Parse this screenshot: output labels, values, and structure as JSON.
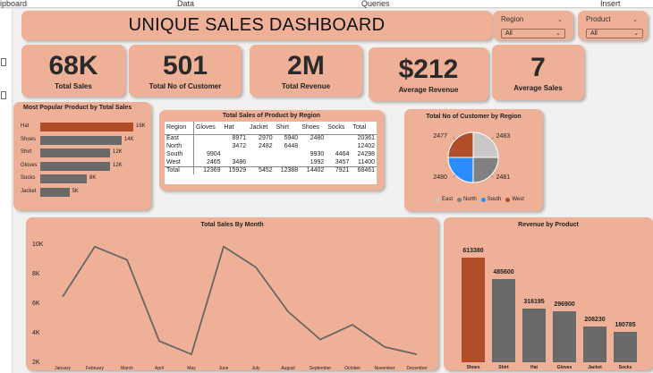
{
  "ribbon": {
    "labels": [
      "ipboard",
      "Data",
      "Queries",
      "Insert"
    ]
  },
  "dashboard": {
    "title": "UNIQUE SALES DASHBOARD"
  },
  "slicers": [
    {
      "title": "Region",
      "value": "All"
    },
    {
      "title": "Product",
      "value": "All"
    }
  ],
  "kpis": [
    {
      "value": "68K",
      "label": "Total Sales"
    },
    {
      "value": "501",
      "label": "Total No of Customer"
    },
    {
      "value": "2M",
      "label": "Total Revenue"
    },
    {
      "value": "$212",
      "label": "Average Revenue"
    },
    {
      "value": "7",
      "label": "Average Sales"
    }
  ],
  "colors": {
    "card": "#efb098",
    "accent": "#b14e2a",
    "bar": "#696969",
    "east": "#c8c8c8",
    "north": "#808080",
    "south": "#2a8cff",
    "west": "#b14e2a"
  },
  "chart_data": [
    {
      "type": "bar",
      "orientation": "horizontal",
      "title": "Most Popular Product by Total Sales",
      "categories": [
        "Hat",
        "Shoes",
        "Shirt",
        "Gloves",
        "Socks",
        "Jacket"
      ],
      "values": [
        16000,
        14000,
        12000,
        12000,
        8000,
        5000
      ],
      "data_labels": [
        "16K",
        "14K",
        "12K",
        "12K",
        "8K",
        "5K"
      ],
      "highlight": "Hat"
    },
    {
      "type": "table",
      "title": "Total Sales of Product by Region",
      "columns": [
        "Region",
        "Gloves",
        "Hat",
        "Jacket",
        "Shirt",
        "Shoes",
        "Socks",
        "Total"
      ],
      "rows": [
        [
          "East",
          "",
          "8971",
          "2970",
          "5940",
          "2480",
          "",
          "20361"
        ],
        [
          "North",
          "",
          "3472",
          "2482",
          "6448",
          "",
          "",
          "12402"
        ],
        [
          "South",
          "9904",
          "",
          "",
          "",
          "9930",
          "4464",
          "24298"
        ],
        [
          "West",
          "2465",
          "3486",
          "",
          "",
          "1992",
          "3457",
          "11400"
        ],
        [
          "Total",
          "12369",
          "15929",
          "5452",
          "12388",
          "14402",
          "7921",
          "68461"
        ]
      ]
    },
    {
      "type": "pie",
      "title": "Total No of Customer by Region",
      "categories": [
        "East",
        "North",
        "South",
        "West"
      ],
      "values": [
        2483,
        2481,
        2480,
        2477
      ],
      "labels": [
        "2483",
        "2481",
        "2480",
        "2477"
      ],
      "legend": "bottom"
    },
    {
      "type": "line",
      "title": "Total Sales By Month",
      "x": [
        "January",
        "February",
        "March",
        "April",
        "May",
        "June",
        "July",
        "August",
        "September",
        "October",
        "November",
        "December"
      ],
      "values": [
        6500,
        9900,
        9000,
        3500,
        2600,
        9900,
        8500,
        5500,
        3600,
        4600,
        3100,
        2600
      ],
      "yticks": [
        "10K",
        "8K",
        "6K",
        "4K",
        "2K"
      ],
      "ylim": [
        2000,
        10000
      ]
    },
    {
      "type": "bar",
      "title": "Revenue by Product",
      "categories": [
        "Shoes",
        "Shirt",
        "Hat",
        "Gloves",
        "Jacket",
        "Socks"
      ],
      "values": [
        613380,
        485600,
        316195,
        296900,
        208230,
        180785
      ],
      "data_labels": [
        "613380",
        "485600",
        "316195",
        "296900",
        "208230",
        "180785"
      ],
      "highlight": "Shoes"
    }
  ]
}
